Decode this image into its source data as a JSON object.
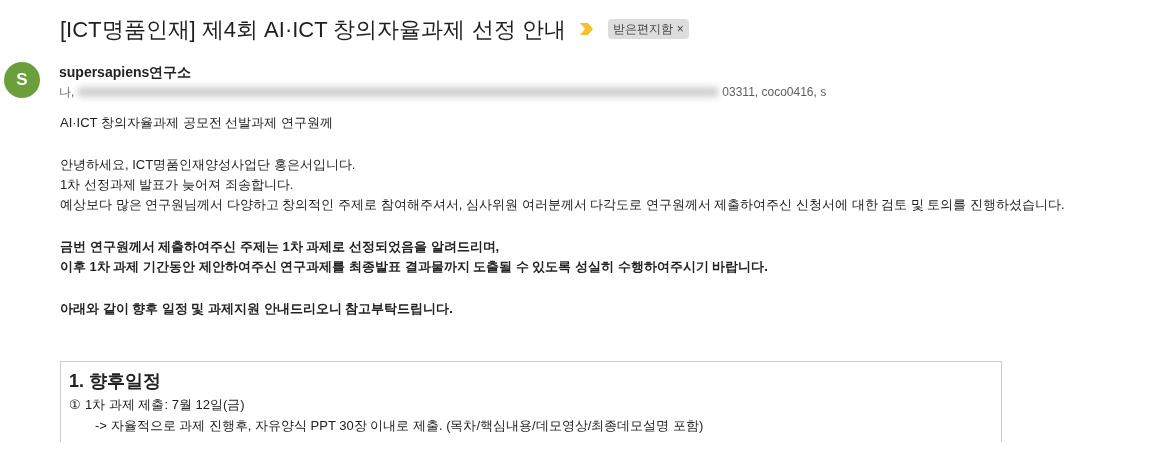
{
  "subject": {
    "title": "[ICT명품인재] 제4회 AI·ICT 창의자율과제 선정 안내",
    "label": "받은편지함",
    "label_close": "×"
  },
  "sender": {
    "avatar": "S",
    "name": "supersapiens연구소",
    "to_prefix": "나,",
    "to_visible": "03311, coco0416, s"
  },
  "body": [
    {
      "kind": "plain",
      "lines": [
        "AI·ICT 창의자율과제 공모전 선발과제 연구원께"
      ]
    },
    {
      "kind": "plain",
      "lines": [
        "안녕하세요, ICT명품인재양성사업단 홍은서입니다.",
        "1차 선정과제 발표가 늦어져 죄송합니다.",
        "예상보다 많은 연구원님께서 다양하고 창의적인 주제로 참여해주셔서, 심사위원 여러분께서 다각도로 연구원께서 제출하여주신 신청서에 대한 검토 및 토의를 진행하셨습니다."
      ]
    },
    {
      "kind": "bold",
      "lines": [
        "금번 연구원께서 제출하여주신 주제는 1차 과제로 선정되었음을 알려드리며,",
        "이후 1차 과제 기간동안 제안하여주신 연구과제를 최종발표 결과물까지 도출될 수 있도록 성실히 수행하여주시기 바랍니다."
      ]
    },
    {
      "kind": "bold",
      "lines": [
        "아래와 같이 향후 일정 및 과제지원 안내드리오니 참고부탁드립니다."
      ]
    }
  ],
  "schedule": {
    "heading": "1. 향후일정",
    "items": [
      {
        "marker": "①",
        "text": "1차 과제 제출: 7월 12일(금)",
        "detail": "-> 자율적으로 과제 진행후, 자유양식 PPT 30장 이내로 제출. (목차/핵심내용/데모영상/최종데모설명 포함)"
      }
    ]
  }
}
